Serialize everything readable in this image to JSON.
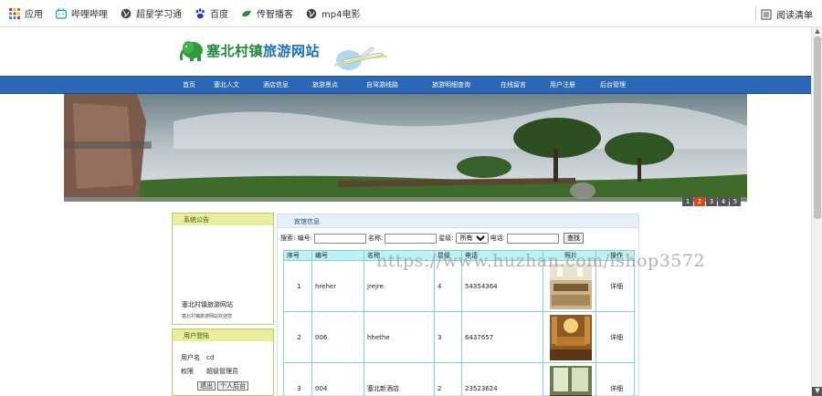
{
  "bookmarks": [
    {
      "label": "应用",
      "icon": "apps-grid-icon"
    },
    {
      "label": "哔哩哔哩",
      "icon": "bilibili-icon"
    },
    {
      "label": "超星学习通",
      "icon": "globe-icon"
    },
    {
      "label": "百度",
      "icon": "baidu-paw-icon"
    },
    {
      "label": "传智播客",
      "icon": "bird-icon"
    },
    {
      "label": "mp4电影",
      "icon": "globe-icon"
    }
  ],
  "reading_list": "阅读清单",
  "site": {
    "title_main": "塞北村镇",
    "title_sub": "旅游网站"
  },
  "nav": [
    "首页",
    "塞北人文",
    "酒店信息",
    "旅游景点",
    "自驾游线路",
    "旅游明细查询",
    "在线留言",
    "用户注册",
    "后台管理"
  ],
  "pager": [
    "1",
    "2",
    "3",
    "4",
    "5"
  ],
  "notice": {
    "title": "系统公告",
    "line1": "塞北村镇旅游网站",
    "line2": "塞北村镇旅游网站欢迎您"
  },
  "user_panel": {
    "title": "用户登陆",
    "username_label": "用户名",
    "username": "cd",
    "role_label": "权限",
    "role": "超级管理员",
    "logout": "退出",
    "profile": "个人后台"
  },
  "content": {
    "title": "宾馆信息",
    "search": {
      "id_label": "搜索: 编号:",
      "name_label": "名称:",
      "level_label": "星级:",
      "level_value": "所有",
      "phone_label": "电话:",
      "button": "查找"
    },
    "columns": [
      "序号",
      "编号",
      "名称",
      "星级",
      "电话",
      "照片",
      "操作"
    ],
    "rows": [
      {
        "no": "1",
        "code": "hreher",
        "name": "jrejre",
        "star": "4",
        "phone": "54354364",
        "action": "详细"
      },
      {
        "no": "2",
        "code": "006",
        "name": "hhethe",
        "star": "3",
        "phone": "6437657",
        "action": "详细"
      },
      {
        "no": "3",
        "code": "004",
        "name": "塞北新酒店",
        "star": "2",
        "phone": "23523624",
        "action": "详细"
      }
    ]
  },
  "watermark": "https://www.huzhan.com/ishop3572",
  "colors": {
    "nav_bg": "#2a67b4",
    "panel_header": "#e8ee9c",
    "table_header": "#bff0f2"
  }
}
